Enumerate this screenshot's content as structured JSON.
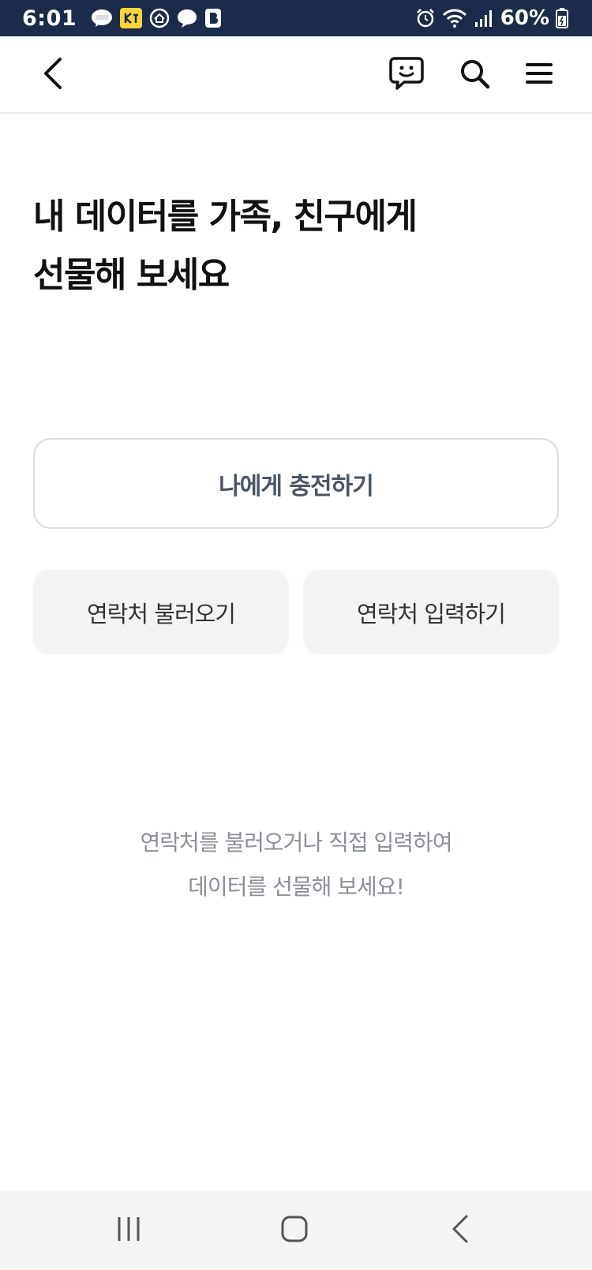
{
  "status_bar": {
    "time": "6:01",
    "battery_percent": "60%",
    "icons_left": [
      "kakaotalk-icon",
      "kakaopay-icon",
      "home-icon",
      "chat-bubble-icon",
      "b-badge-icon"
    ],
    "icons_right": [
      "alarm-icon",
      "wifi-icon",
      "signal-icon",
      "battery-icon"
    ]
  },
  "header": {
    "icons": [
      "back-arrow-icon",
      "chat-smile-icon",
      "search-icon",
      "hamburger-menu-icon"
    ]
  },
  "main": {
    "headline_line1": "내 데이터를 가족, 친구에게",
    "headline_line2": "선물해 보세요",
    "charge_me_label": "나에게 충전하기",
    "load_contacts_label": "연락처 불러오기",
    "input_contact_label": "연락처 입력하기",
    "hint_line1": "연락처를 불러오거나 직접 입력하여",
    "hint_line2": "데이터를 선물해 보세요!"
  },
  "nav_bar": {
    "icons": [
      "recent-apps-icon",
      "home-button-icon",
      "back-icon"
    ]
  },
  "colors": {
    "status_bar_bg": "#1c2b4a",
    "soft_button_bg": "#f2f4f6",
    "hint_text": "#8a8f98"
  }
}
